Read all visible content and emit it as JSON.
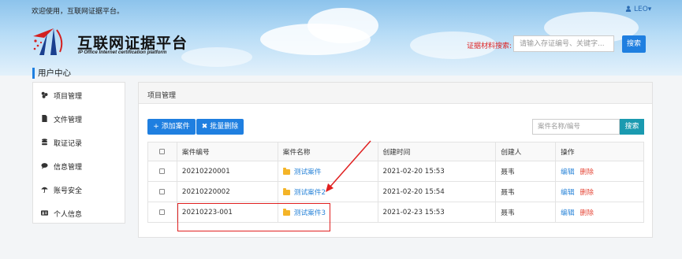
{
  "topbar": {
    "welcome": "欢迎使用，互联网证据平台。",
    "user_label": "LEO",
    "user_caret": "▾"
  },
  "logo": {
    "title": "互联网证据平台",
    "subtitle": "IP Office Internet certification platform"
  },
  "evidence_search": {
    "label": "证据材料搜索:",
    "placeholder": "请输入存证编号、关键字...",
    "button": "搜索"
  },
  "user_center": "用户中心",
  "sidebar": {
    "items": [
      {
        "icon": "project-icon",
        "label": "项目管理"
      },
      {
        "icon": "file-icon",
        "label": "文件管理"
      },
      {
        "icon": "database-icon",
        "label": "取证记录"
      },
      {
        "icon": "message-icon",
        "label": "信息管理"
      },
      {
        "icon": "umbrella-icon",
        "label": "账号安全"
      },
      {
        "icon": "id-card-icon",
        "label": "个人信息"
      }
    ]
  },
  "panel": {
    "title": "项目管理",
    "add_button": "+ 添加案件",
    "batch_delete_button": "✖ 批量删除",
    "search_placeholder": "案件名称/编号",
    "search_button": "搜索"
  },
  "table": {
    "headers": [
      "",
      "案件编号",
      "案件名称",
      "创建时间",
      "创建人",
      "操作"
    ],
    "rows": [
      {
        "id": "20210220001",
        "name": "测试案件",
        "created": "2021-02-20 15:53",
        "creator": "聂韦",
        "edit": "编辑",
        "delete": "删除"
      },
      {
        "id": "20210220002",
        "name": "测试案件2",
        "created": "2021-02-20 15:54",
        "creator": "聂韦",
        "edit": "编辑",
        "delete": "删除"
      },
      {
        "id": "20210223-001",
        "name": "测试案件3",
        "created": "2021-02-23 15:53",
        "creator": "聂韦",
        "edit": "编辑",
        "delete": "删除"
      }
    ]
  },
  "colors": {
    "primary": "#1f7fe0",
    "teal": "#1a9ab0",
    "danger": "#e64b3c",
    "annotation": "#e02020"
  }
}
